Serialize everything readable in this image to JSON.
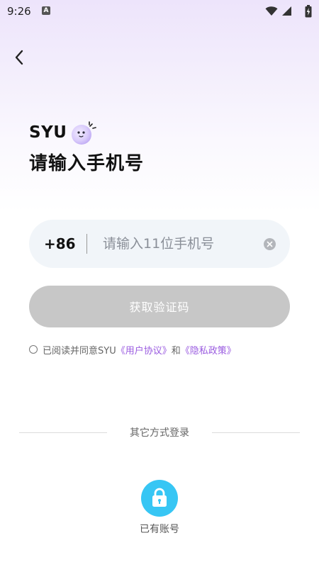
{
  "status_bar": {
    "time": "9:26",
    "notification_icon": "a-icon",
    "icons": [
      "wifi-icon",
      "signal-icon",
      "battery-icon"
    ]
  },
  "header": {
    "back_icon": "chevron-left-icon"
  },
  "brand": {
    "name": "SYU",
    "mascot_icon": "mascot-icon"
  },
  "title": "请输入手机号",
  "phone_field": {
    "country_code": "+86",
    "value": "",
    "placeholder": "请输入11位手机号",
    "clear_icon": "clear-icon"
  },
  "code_button": {
    "label": "获取验证码",
    "enabled": false
  },
  "agreement": {
    "prefix": "已阅读并同意SYU",
    "user_agreement": "《用户协议》",
    "conjunction": "和",
    "privacy_policy": "《隐私政策》",
    "checked": false
  },
  "other_login": {
    "label": "其它方式登录",
    "options": [
      {
        "label": "已有账号",
        "icon": "lock-icon"
      }
    ]
  },
  "colors": {
    "accent": "#9a5be0",
    "lock_bg": "#37c6f4",
    "disabled_button": "#c7c7c7",
    "field_bg": "#f1f5f9"
  }
}
